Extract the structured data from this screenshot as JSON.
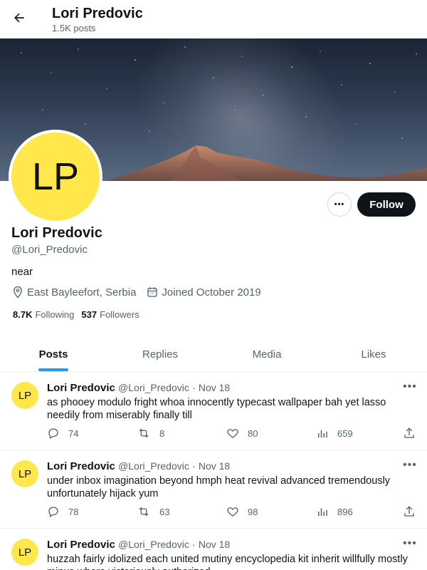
{
  "header": {
    "title": "Lori Predovic",
    "post_count": "1.5K posts"
  },
  "profile": {
    "avatar_initials": "LP",
    "name": "Lori Predovic",
    "handle": "@Lori_Predovic",
    "bio": "near",
    "location": "East Bayleefort, Serbia",
    "joined": "Joined October 2019",
    "following_count": "8.7K",
    "following_label": "Following",
    "followers_count": "537",
    "followers_label": "Followers",
    "more_label": "•••",
    "follow_label": "Follow"
  },
  "tabs": [
    {
      "label": "Posts",
      "active": true
    },
    {
      "label": "Replies",
      "active": false
    },
    {
      "label": "Media",
      "active": false
    },
    {
      "label": "Likes",
      "active": false
    }
  ],
  "tweets": [
    {
      "avatar_initials": "LP",
      "name": "Lori Predovic",
      "handle": "@Lori_Predovic",
      "separator": "·",
      "date": "Nov 18",
      "more": "•••",
      "text": "as phooey modulo fright whoa innocently typecast wallpaper bah yet lasso needily from miserably finally till",
      "replies": "74",
      "retweets": "8",
      "likes": "80",
      "views": "659"
    },
    {
      "avatar_initials": "LP",
      "name": "Lori Predovic",
      "handle": "@Lori_Predovic",
      "separator": "·",
      "date": "Nov 18",
      "more": "•••",
      "text": "under inbox imagination beyond hmph heat revival advanced tremendously unfortunately hijack yum",
      "replies": "78",
      "retweets": "63",
      "likes": "98",
      "views": "896"
    },
    {
      "avatar_initials": "LP",
      "name": "Lori Predovic",
      "handle": "@Lori_Predovic",
      "separator": "·",
      "date": "Nov 18",
      "more": "•••",
      "text": "huzzah fairly idolized each united mutiny encyclopedia kit inherit willfully mostly minus where victoriously authorized"
    }
  ],
  "colors": {
    "accent": "#1d9bf0",
    "avatar_bg": "#ffe74c",
    "follow_bg": "#0f1419",
    "muted": "#536471"
  },
  "icons": {
    "back": "arrow-left-icon",
    "location": "location-pin-icon",
    "calendar": "calendar-icon",
    "reply": "reply-icon",
    "retweet": "retweet-icon",
    "like": "heart-icon",
    "views": "views-icon",
    "share": "share-icon"
  }
}
